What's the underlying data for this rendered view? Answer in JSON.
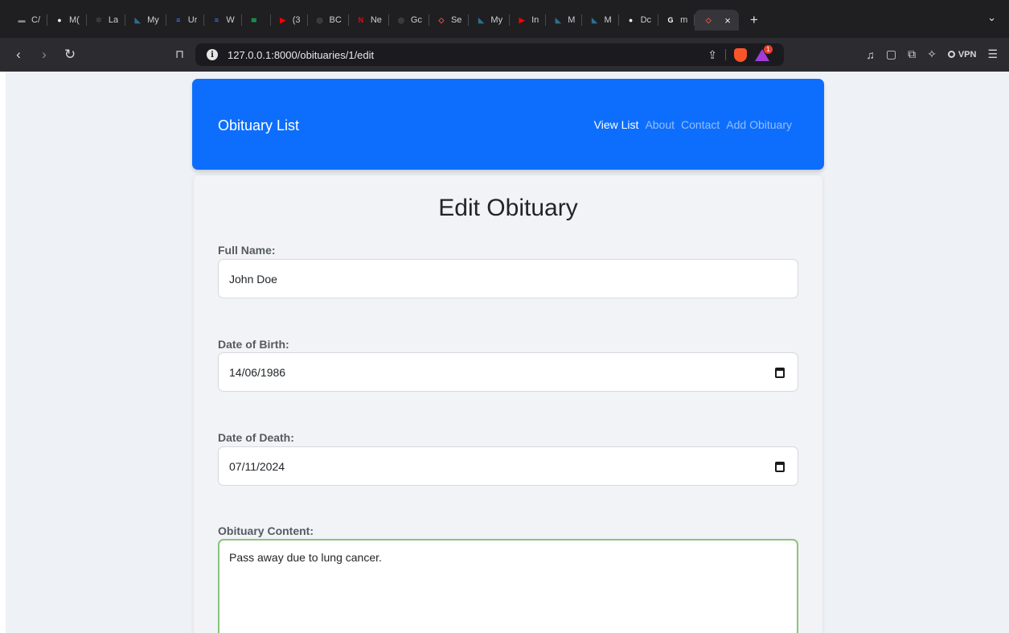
{
  "browser": {
    "tabs": [
      {
        "label": "C/",
        "fav_color": "#8a8a8e",
        "fav_glyph": "▬"
      },
      {
        "label": "M(",
        "fav_color": "#f0f0f0",
        "fav_glyph": "●"
      },
      {
        "label": "La",
        "fav_color": "#444",
        "fav_glyph": "✲"
      },
      {
        "label": "My",
        "fav_color": "#2d6f8f",
        "fav_glyph": "◣"
      },
      {
        "label": "Ur",
        "fav_color": "#4285f4",
        "fav_glyph": "≡"
      },
      {
        "label": "W",
        "fav_color": "#4285f4",
        "fav_glyph": "≡"
      },
      {
        "label": "",
        "fav_color": "#1db954",
        "fav_glyph": "≋"
      },
      {
        "label": "(3",
        "fav_color": "#ff0000",
        "fav_glyph": "▶"
      },
      {
        "label": "BC",
        "fav_color": "#555",
        "fav_glyph": "◎"
      },
      {
        "label": "Ne",
        "fav_color": "#e50914",
        "fav_glyph": "N"
      },
      {
        "label": "Gc",
        "fav_color": "#555",
        "fav_glyph": "◎"
      },
      {
        "label": "Se",
        "fav_color": "#f05340",
        "fav_glyph": "◇"
      },
      {
        "label": "My",
        "fav_color": "#2d6f8f",
        "fav_glyph": "◣"
      },
      {
        "label": "In",
        "fav_color": "#ff0000",
        "fav_glyph": "▶"
      },
      {
        "label": "M",
        "fav_color": "#2d6f8f",
        "fav_glyph": "◣"
      },
      {
        "label": "M",
        "fav_color": "#2d6f8f",
        "fav_glyph": "◣"
      },
      {
        "label": "Dc",
        "fav_color": "#f0f0f0",
        "fav_glyph": "●"
      },
      {
        "label": "m",
        "fav_color": "#ffffff",
        "fav_glyph": "G"
      }
    ],
    "active_tab_close": "×",
    "new_tab": "+",
    "tab_menu": "⌄",
    "url": "127.0.0.1:8000/obituaries/1/edit",
    "rewards_badge": "1",
    "vpn_label": "VPN"
  },
  "navbar": {
    "brand": "Obituary List",
    "links": [
      "View List",
      "About",
      "Contact",
      "Add Obituary"
    ]
  },
  "form": {
    "title": "Edit Obituary",
    "full_name_label": "Full Name:",
    "full_name_value": "John Doe",
    "dob_label": "Date of Birth:",
    "dob_value": "14/06/1986",
    "dod_label": "Date of Death:",
    "dod_value": "07/11/2024",
    "content_label": "Obituary Content:",
    "content_value": "Pass away due to lung cancer."
  }
}
